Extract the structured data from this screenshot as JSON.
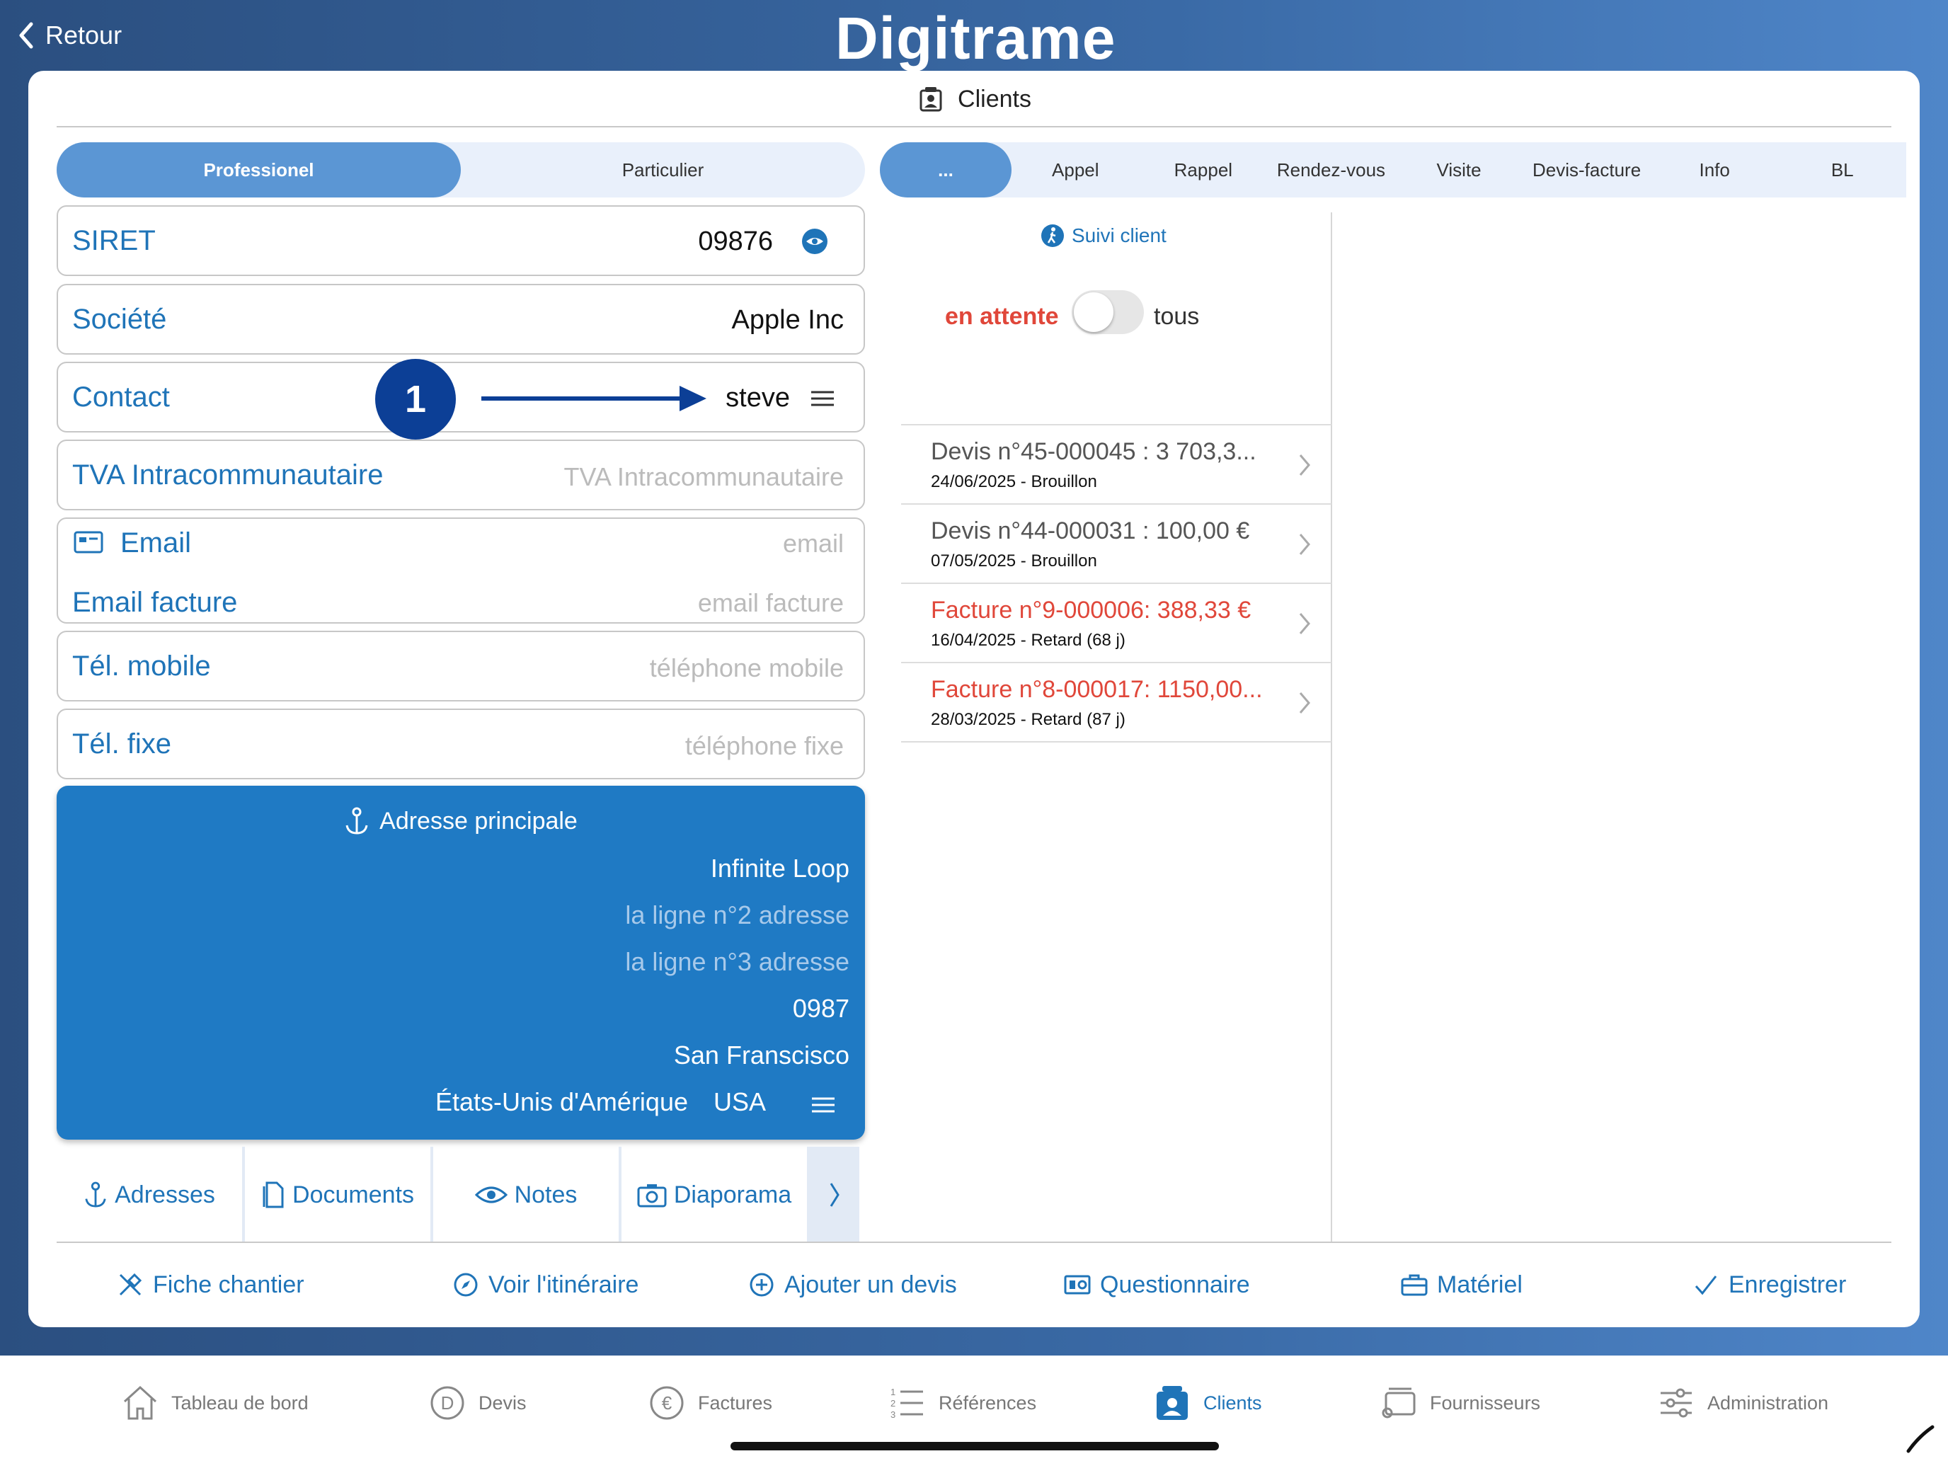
{
  "app": {
    "logo": "Digitrame",
    "back_label": "Retour"
  },
  "page": {
    "title": "Clients"
  },
  "client_type": {
    "options": [
      "Professionel",
      "Particulier"
    ],
    "selected": "Professionel"
  },
  "filters": {
    "options": [
      "...",
      "Appel",
      "Rappel",
      "Rendez-vous",
      "Visite",
      "Devis-facture",
      "Info",
      "BL"
    ],
    "selected": "..."
  },
  "fields": {
    "siret": {
      "label": "SIRET",
      "value": "09876"
    },
    "societe": {
      "label": "Société",
      "value": "Apple Inc"
    },
    "contact": {
      "label": "Contact",
      "value": "steve",
      "badge": "1"
    },
    "tva": {
      "label": "TVA Intracommunautaire",
      "placeholder": "TVA Intracommunautaire"
    },
    "email": {
      "label": "Email",
      "placeholder": "email"
    },
    "email_facture": {
      "label": "Email facture",
      "placeholder": "email facture"
    },
    "tel_mobile": {
      "label": "Tél. mobile",
      "placeholder": "téléphone mobile"
    },
    "tel_fixe": {
      "label": "Tél. fixe",
      "placeholder": "téléphone fixe"
    }
  },
  "address": {
    "title": "Adresse principale",
    "line1": "Infinite Loop",
    "line2_placeholder": "la ligne n°2 adresse",
    "line3_placeholder": "la ligne n°3 adresse",
    "postcode": "0987",
    "city": "San Franscisco",
    "country": "États-Unis d'Amérique",
    "country_code": "USA"
  },
  "bottom_tabs": [
    "Adresses",
    "Documents",
    "Notes",
    "Diaporama"
  ],
  "suivi": {
    "title": "Suivi client",
    "toggle_left": "en attente",
    "toggle_right": "tous"
  },
  "documents": [
    {
      "title": "Devis n°45-000045 : 3 703,3...",
      "sub": "24/06/2025 - Brouillon",
      "status": "draft"
    },
    {
      "title": "Devis n°44-000031 : 100,00 €",
      "sub": "07/05/2025 - Brouillon",
      "status": "draft"
    },
    {
      "title": "Facture n°9-000006: 388,33 €",
      "sub": "16/04/2025  - Retard  (68 j)",
      "status": "late"
    },
    {
      "title": "Facture n°8-000017: 1150,00...",
      "sub": "28/03/2025  - Retard  (87 j)",
      "status": "late"
    }
  ],
  "actions": [
    "Fiche chantier",
    "Voir l'itinéraire",
    "Ajouter un devis",
    "Questionnaire",
    "Matériel",
    "Enregistrer"
  ],
  "tabbar": {
    "items": [
      "Tableau de bord",
      "Devis",
      "Factures",
      "Références",
      "Clients",
      "Fournisseurs",
      "Administration"
    ],
    "selected": "Clients"
  },
  "colors": {
    "accent": "#1f74b8",
    "late": "#e0473a",
    "selected_segment": "#5b96d4",
    "address_bg": "#1f7ac4"
  }
}
